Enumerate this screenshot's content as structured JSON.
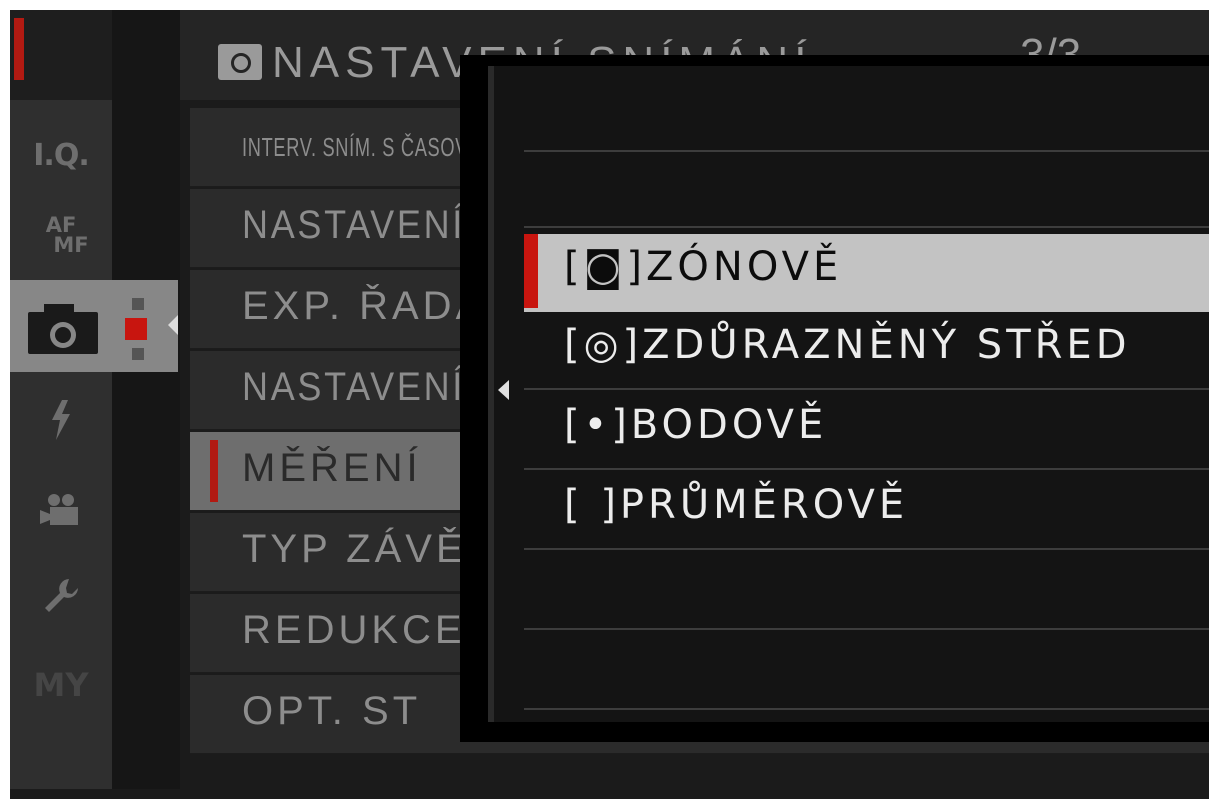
{
  "rail": {
    "items": [
      {
        "label": "I.Q."
      },
      {
        "label_top": "AF",
        "label_bottom": "MF"
      },
      {
        "name": "camera"
      },
      {
        "name": "flash"
      },
      {
        "name": "movie"
      },
      {
        "name": "wrench"
      },
      {
        "label": "MY"
      }
    ]
  },
  "menu": {
    "title": "NASTAVENÍ SNÍMÁNÍ",
    "page": "3/3",
    "items": [
      {
        "label": "INTERV. SNÍM. S ČASOVAČEM"
      },
      {
        "label": "NASTAVENÍ"
      },
      {
        "label": "EXP. ŘADA"
      },
      {
        "label": "NASTAVENÍ"
      },
      {
        "label": "MĚŘENÍ"
      },
      {
        "label": "TYP ZÁVĚRKY"
      },
      {
        "label": "REDUKCE"
      },
      {
        "label": "OPT. ST"
      }
    ]
  },
  "popup": {
    "options": [
      {
        "label": ""
      },
      {
        "label": ""
      },
      {
        "label": "[◙]ZÓNOVĚ"
      },
      {
        "label": "[◎]ZDŮRAZNĚNÝ STŘED"
      },
      {
        "label": "[•]BODOVĚ"
      },
      {
        "label": "[ ]PRŮMĚROVĚ"
      },
      {
        "label": ""
      },
      {
        "label": ""
      }
    ]
  },
  "colors": {
    "accent": "#c8150f",
    "selected_row": "#c3c3c3"
  }
}
